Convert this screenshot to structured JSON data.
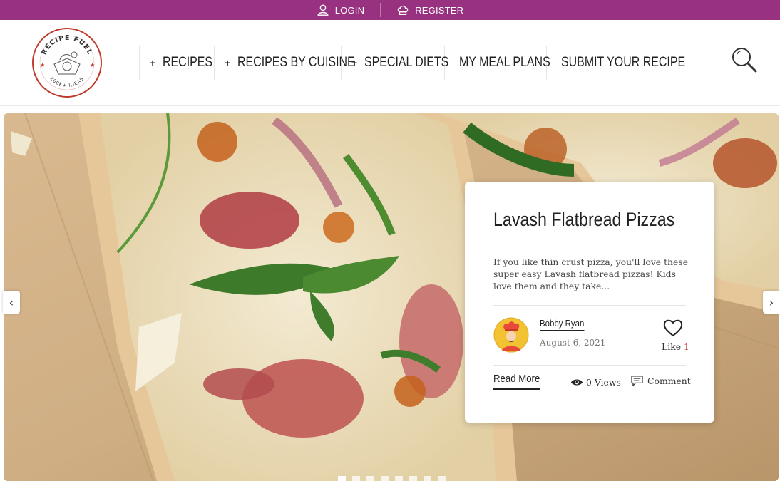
{
  "topbar": {
    "login_label": "LOGIN",
    "register_label": "REGISTER",
    "background_color": "#983280"
  },
  "logo": {
    "text_top": "RECIPE FUEL",
    "text_bottom": "200K+ IDEAS",
    "accent_color": "#c0392b"
  },
  "nav": {
    "items": [
      {
        "label": "RECIPES",
        "has_submenu": true
      },
      {
        "label": "RECIPES BY CUISINE",
        "has_submenu": true
      },
      {
        "label": "SPECIAL DIETS",
        "has_submenu": true
      },
      {
        "label": "MY MEAL PLANS",
        "has_submenu": false
      },
      {
        "label": "SUBMIT YOUR RECIPE",
        "has_submenu": false
      }
    ],
    "plus_symbol": "+",
    "search_icon": "search-icon"
  },
  "slider": {
    "prev_icon": "chevron-left-icon",
    "next_icon": "chevron-right-icon",
    "prev_glyph": "‹",
    "next_glyph": "›",
    "slide_count": 8,
    "active_slide": 1
  },
  "card": {
    "title": "Lavash Flatbread Pizzas",
    "excerpt": "If you like thin crust pizza, you'll love these super easy Lavash flatbread pizzas! Kids love them and they take...",
    "author_name": "Bobby Ryan",
    "date": "August 6, 2021",
    "like_label": "Like",
    "like_count": "1",
    "read_more_label": "Read More",
    "views_label": "0 Views",
    "comment_label": "Comment"
  }
}
